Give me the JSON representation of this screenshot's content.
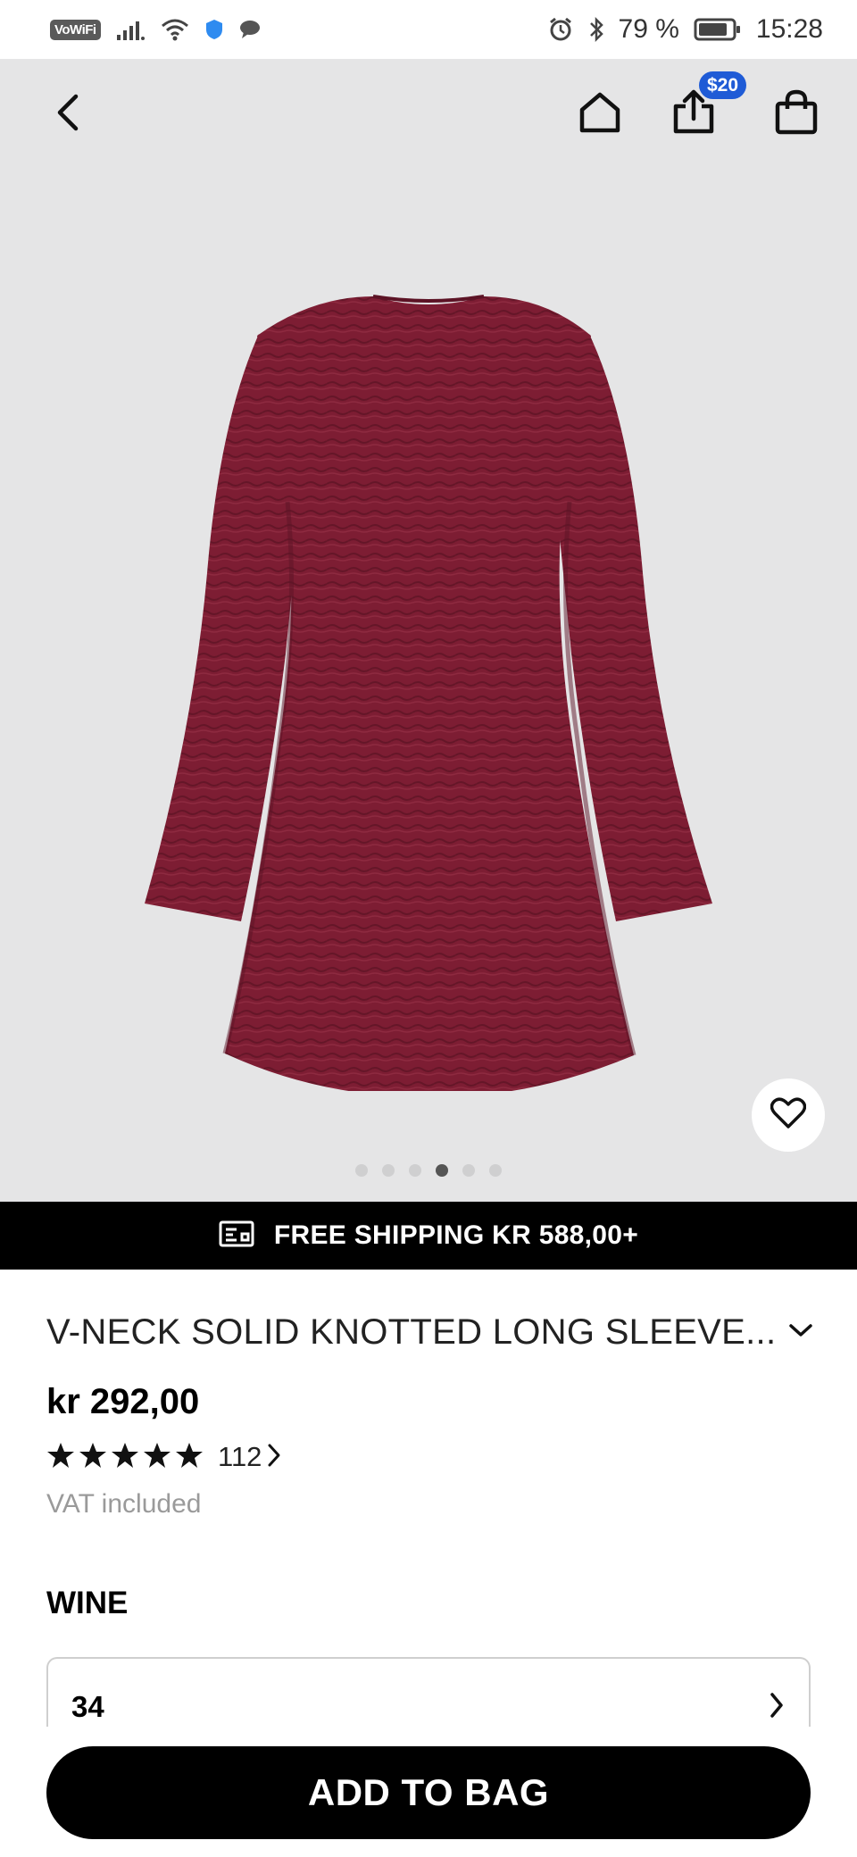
{
  "status_bar": {
    "vowifi": "VoWiFi",
    "battery": "79 %",
    "time": "15:28"
  },
  "nav": {
    "share_badge": "$20"
  },
  "gallery": {
    "dot_count": 6,
    "active_index": 3
  },
  "shipping_banner": "FREE SHIPPING KR 588,00+",
  "product": {
    "title": "V-NECK SOLID KNOTTED LONG SLEEVE...",
    "price": "kr 292,00",
    "rating_stars": 5,
    "review_count": "112",
    "vat_note": "VAT included",
    "color": "WINE",
    "size": "34"
  },
  "add_to_bag_label": "ADD TO BAG",
  "colors": {
    "hero_bg": "#e5e5e6",
    "dress": "#7d1d33",
    "badge": "#1f5bd6"
  },
  "icons": [
    "back-arrow-icon",
    "home-icon",
    "share-icon",
    "bag-icon",
    "heart-icon",
    "shipping-icon",
    "chevron-down-icon",
    "star-icon",
    "chevron-right-icon"
  ]
}
